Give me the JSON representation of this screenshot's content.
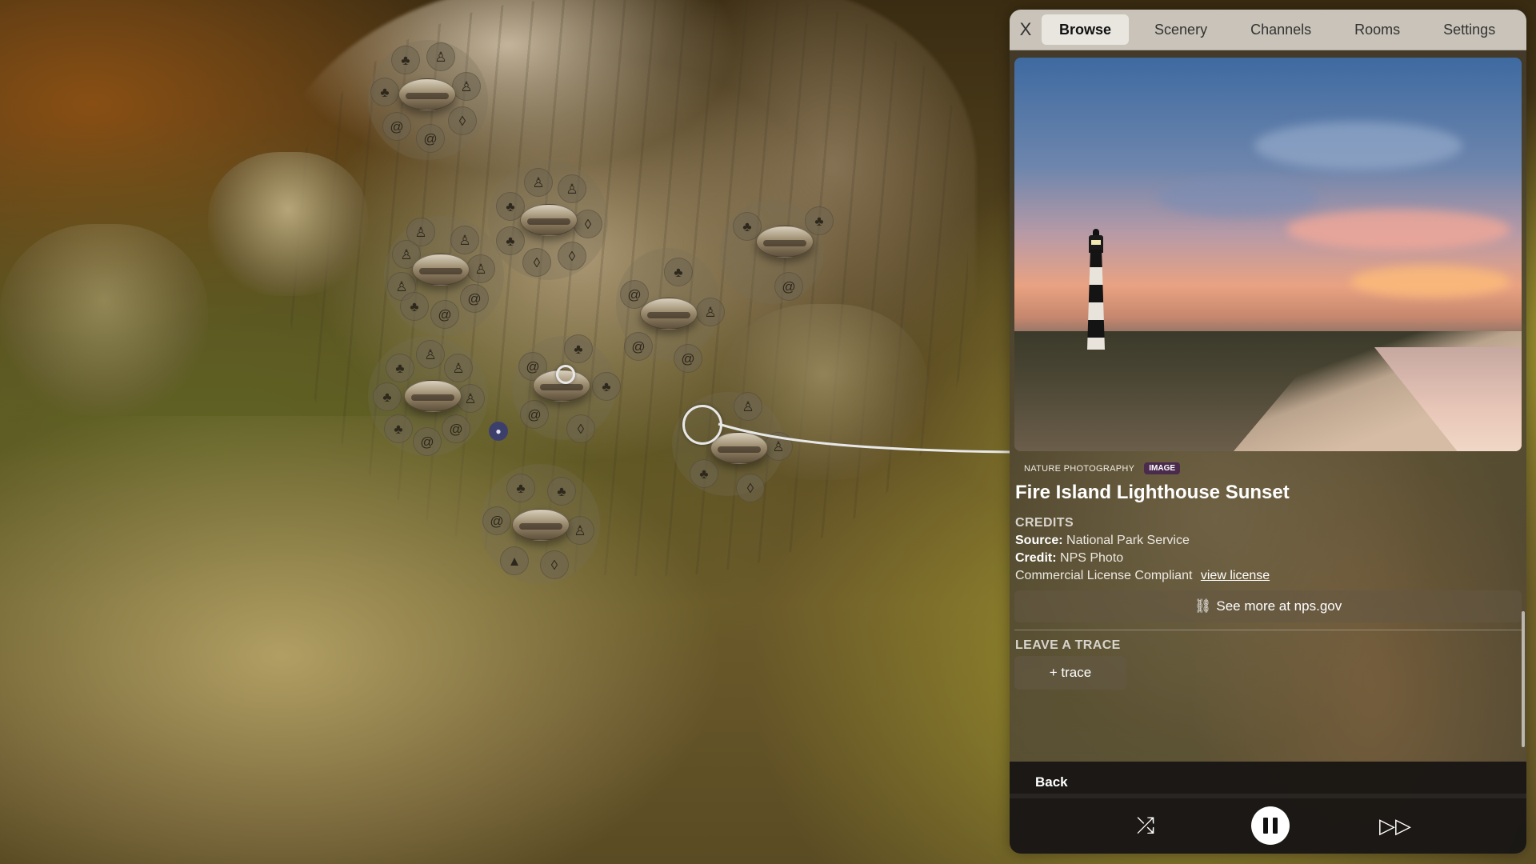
{
  "tabs": {
    "close": "X",
    "items": [
      {
        "label": "Browse",
        "active": true
      },
      {
        "label": "Scenery",
        "active": false
      },
      {
        "label": "Channels",
        "active": false
      },
      {
        "label": "Rooms",
        "active": false
      },
      {
        "label": "Settings",
        "active": false
      }
    ]
  },
  "item": {
    "category": "NATURE PHOTOGRAPHY",
    "badge": "IMAGE",
    "title": "Fire Island Lighthouse Sunset"
  },
  "credits": {
    "heading": "CREDITS",
    "source_label": "Source:",
    "source_value": "National Park Service",
    "credit_label": "Credit:",
    "credit_value": "NPS Photo",
    "license_text": "Commercial License Compliant",
    "license_link": "view license"
  },
  "see_more": "See more at nps.gov",
  "trace": {
    "heading": "LEAVE A TRACE",
    "button": "+ trace"
  },
  "player": {
    "back": "Back",
    "shuffle_icon": "shuffle-icon",
    "pause_icon": "pause-icon",
    "next_icon": "next-icon"
  },
  "colors": {
    "badge": "#4a2a4d",
    "panel_tabs": "#e1dcd2",
    "player_bar": "#161412"
  }
}
